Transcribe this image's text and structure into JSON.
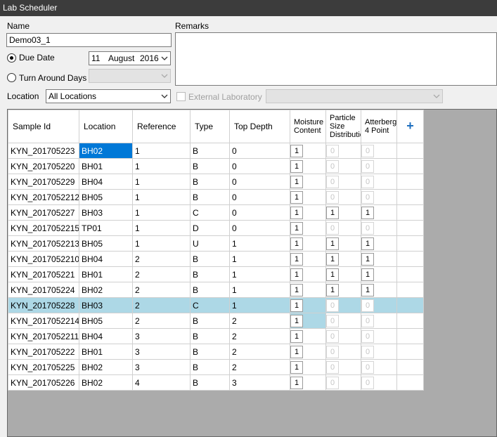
{
  "window": {
    "title": "Lab Scheduler"
  },
  "form": {
    "name_label": "Name",
    "name_value": "Demo03_1",
    "remarks_label": "Remarks",
    "due_date_label": "Due Date",
    "due_day": "11",
    "due_month": "August",
    "due_year": "2016",
    "turnaround_label": "Turn Around Days",
    "location_label": "Location",
    "location_value": "All Locations",
    "external_lab_label": "External Laboratory"
  },
  "grid": {
    "headers": {
      "sample_id": "Sample Id",
      "location": "Location",
      "reference": "Reference",
      "type": "Type",
      "top_depth": "Top Depth",
      "moisture": "Moisture Content",
      "particle": "Particle Size Distribution",
      "atterberg": "Atterberg 4 Point",
      "add": "+"
    },
    "rows": [
      {
        "id": "KYN_201705223",
        "loc": "BH02",
        "ref": "1",
        "type": "B",
        "depth": "0",
        "m": "1",
        "p": "0",
        "a": "0"
      },
      {
        "id": "KYN_201705220",
        "loc": "BH01",
        "ref": "1",
        "type": "B",
        "depth": "0",
        "m": "1",
        "p": "0",
        "a": "0"
      },
      {
        "id": "KYN_201705229",
        "loc": "BH04",
        "ref": "1",
        "type": "B",
        "depth": "0",
        "m": "1",
        "p": "0",
        "a": "0"
      },
      {
        "id": "KYN_2017052212",
        "loc": "BH05",
        "ref": "1",
        "type": "B",
        "depth": "0",
        "m": "1",
        "p": "0",
        "a": "0"
      },
      {
        "id": "KYN_201705227",
        "loc": "BH03",
        "ref": "1",
        "type": "C",
        "depth": "0",
        "m": "1",
        "p": "1",
        "a": "1"
      },
      {
        "id": "KYN_2017052215",
        "loc": "TP01",
        "ref": "1",
        "type": "D",
        "depth": "0",
        "m": "1",
        "p": "0",
        "a": "0"
      },
      {
        "id": "KYN_2017052213",
        "loc": "BH05",
        "ref": "1",
        "type": "U",
        "depth": "1",
        "m": "1",
        "p": "1",
        "a": "1"
      },
      {
        "id": "KYN_2017052210",
        "loc": "BH04",
        "ref": "2",
        "type": "B",
        "depth": "1",
        "m": "1",
        "p": "1",
        "a": "1"
      },
      {
        "id": "KYN_201705221",
        "loc": "BH01",
        "ref": "2",
        "type": "B",
        "depth": "1",
        "m": "1",
        "p": "1",
        "a": "1"
      },
      {
        "id": "KYN_201705224",
        "loc": "BH02",
        "ref": "2",
        "type": "B",
        "depth": "1",
        "m": "1",
        "p": "1",
        "a": "1"
      },
      {
        "id": "KYN_201705228",
        "loc": "BH03",
        "ref": "2",
        "type": "C",
        "depth": "1",
        "m": "1",
        "p": "0",
        "a": "0"
      },
      {
        "id": "KYN_2017052214",
        "loc": "BH05",
        "ref": "2",
        "type": "B",
        "depth": "2",
        "m": "1",
        "p": "0",
        "a": "0"
      },
      {
        "id": "KYN_2017052211",
        "loc": "BH04",
        "ref": "3",
        "type": "B",
        "depth": "2",
        "m": "1",
        "p": "0",
        "a": "0"
      },
      {
        "id": "KYN_201705222",
        "loc": "BH01",
        "ref": "3",
        "type": "B",
        "depth": "2",
        "m": "1",
        "p": "0",
        "a": "0"
      },
      {
        "id": "KYN_201705225",
        "loc": "BH02",
        "ref": "3",
        "type": "B",
        "depth": "2",
        "m": "1",
        "p": "0",
        "a": "0"
      },
      {
        "id": "KYN_201705226",
        "loc": "BH02",
        "ref": "4",
        "type": "B",
        "depth": "3",
        "m": "1",
        "p": "0",
        "a": "0"
      }
    ]
  },
  "colors": {
    "title_bar": "#3c3c3c",
    "selected_row": "#add8e6",
    "selected_cell": "#0078d7",
    "grid_background": "#ababab"
  },
  "icons": {
    "dropdown": "chevron-down-icon",
    "add_column": "plus-icon"
  }
}
